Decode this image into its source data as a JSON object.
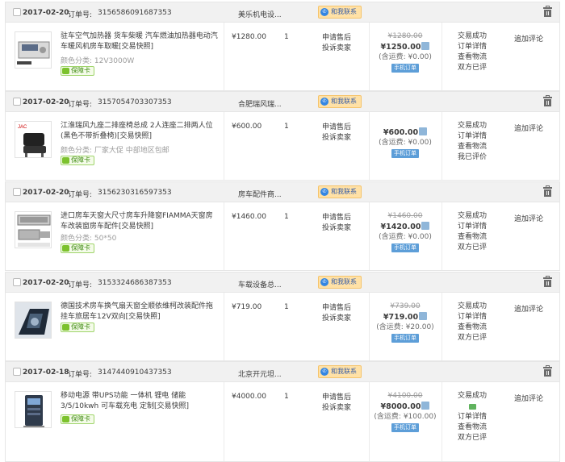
{
  "orders": [
    {
      "date": "2017-02-20",
      "order_no_label": "订单号:",
      "order_no": "3156586091687353",
      "shop": "美乐机电设...",
      "contact_label": "和我联系",
      "title": "驻车空气加热器 货车柴暖 汽车燃油加热器电动汽车暖风机房车取暖",
      "snapshot": "[交易快照]",
      "spec_label": "颜色分类:",
      "spec": "12V3000W",
      "badge": "保障卡",
      "unit_price": "¥1280.00",
      "qty": "1",
      "service": [
        "申请售后",
        "投诉卖家"
      ],
      "original_total": "¥1280.00",
      "paid_total": "¥1250.00",
      "shipping": "(含运费: ¥0.00)",
      "modify_label": "手机订单",
      "status": [
        "交易成功",
        "订单详情",
        "查看物流",
        "双方已评"
      ],
      "show_msg_icon": false,
      "operation": "追加评论"
    },
    {
      "date": "2017-02-20",
      "order_no_label": "订单号:",
      "order_no": "3157054703307353",
      "shop": "合肥瑞风瑞...",
      "contact_label": "和我联系",
      "title": "江淮瑞风九座二排座椅总成 2人连座二排两人位 (黑色不带折叠椅)",
      "snapshot": "[交易快照]",
      "spec_label": "颜色分类:",
      "spec": "厂家大促 中部地区包邮",
      "badge": "保障卡",
      "unit_price": "¥600.00",
      "qty": "1",
      "service": [
        "申请售后",
        "投诉卖家"
      ],
      "original_total": "",
      "paid_total": "¥600.00",
      "shipping": "(含运费: ¥0.00)",
      "modify_label": "手机订单",
      "status": [
        "交易成功",
        "订单详情",
        "查看物流",
        "我已评价"
      ],
      "show_msg_icon": false,
      "operation": "追加评论"
    },
    {
      "date": "2017-02-20",
      "order_no_label": "订单号:",
      "order_no": "3156230316597353",
      "shop": "房车配件商...",
      "contact_label": "和我联系",
      "title": "进口房车天窗大尺寸房车升降窗FIAMMA天窗房车改装窗房车配件",
      "snapshot": "[交易快照]",
      "spec_label": "颜色分类:",
      "spec": "50*50",
      "badge": "保障卡",
      "unit_price": "¥1460.00",
      "qty": "1",
      "service": [
        "申请售后",
        "投诉卖家"
      ],
      "original_total": "¥1460.00",
      "paid_total": "¥1420.00",
      "shipping": "(含运费: ¥0.00)",
      "modify_label": "手机订单",
      "status": [
        "交易成功",
        "订单详情",
        "查看物流",
        "双方已评"
      ],
      "show_msg_icon": false,
      "operation": "追加评论"
    },
    {
      "date": "2017-02-20",
      "order_no_label": "订单号:",
      "order_no": "3153324686387353",
      "shop": "车载设备总...",
      "contact_label": "和我联系",
      "title": "德国技术房车换气扇天窗全顺依维柯改装配件拖挂车旅居车12V双向",
      "snapshot": "[交易快照]",
      "spec_label": "",
      "spec": "",
      "badge": "保障卡",
      "unit_price": "¥719.00",
      "qty": "1",
      "service": [
        "申请售后",
        "投诉卖家"
      ],
      "original_total": "¥739.00",
      "paid_total": "¥719.00",
      "shipping": "(含运费: ¥20.00)",
      "modify_label": "手机订单",
      "status": [
        "交易成功",
        "订单详情",
        "查看物流",
        "双方已评"
      ],
      "show_msg_icon": false,
      "operation": "追加评论"
    },
    {
      "date": "2017-02-18",
      "order_no_label": "订单号:",
      "order_no": "3147440910437353",
      "shop": "北京开元坦...",
      "contact_label": "和我联系",
      "title": "移动电源 带UPS功能 一体机 锂电 储能3/5/10kwh 可车载充电 定制",
      "snapshot": "[交易快照]",
      "spec_label": "",
      "spec": "",
      "badge": "保障卡",
      "unit_price": "¥4000.00",
      "qty": "1",
      "service": [
        "申请售后",
        "投诉卖家"
      ],
      "original_total": "¥4100.00",
      "paid_total": "¥8000.00",
      "shipping": "(含运费: ¥100.00)",
      "modify_label": "手机订单",
      "status": [
        "交易成功",
        "订单详情",
        "查看物流",
        "双方已评"
      ],
      "show_msg_icon": true,
      "operation": "追加评论"
    }
  ]
}
